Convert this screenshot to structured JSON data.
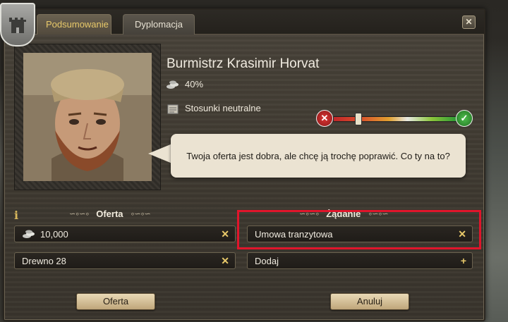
{
  "tabs": [
    {
      "label": "Podsumowanie",
      "active": true
    },
    {
      "label": "Dyplomacja",
      "active": false
    }
  ],
  "close_label": "✕",
  "character": {
    "name": "Burmistrz Krasimir Horvat",
    "stat_value": "40%",
    "relation": "Stosunki neutralne",
    "relation_level": 0.2
  },
  "dialogue": "Twoja oferta jest dobra, ale chcę ją trochę poprawić. Co ty na to?",
  "offer": {
    "title": "Oferta",
    "items": [
      {
        "label": "10,000",
        "icon": "coins-icon"
      },
      {
        "label": "Drewno 28"
      }
    ]
  },
  "demand": {
    "title": "Żądanie",
    "items": [
      {
        "label": "Umowa tranzytowa"
      },
      {
        "label": "Dodaj"
      }
    ]
  },
  "buttons": {
    "offer": "Oferta",
    "cancel": "Anuluj"
  },
  "colors": {
    "accent_gold": "#e8c96a",
    "highlight_red": "#e0152b"
  }
}
